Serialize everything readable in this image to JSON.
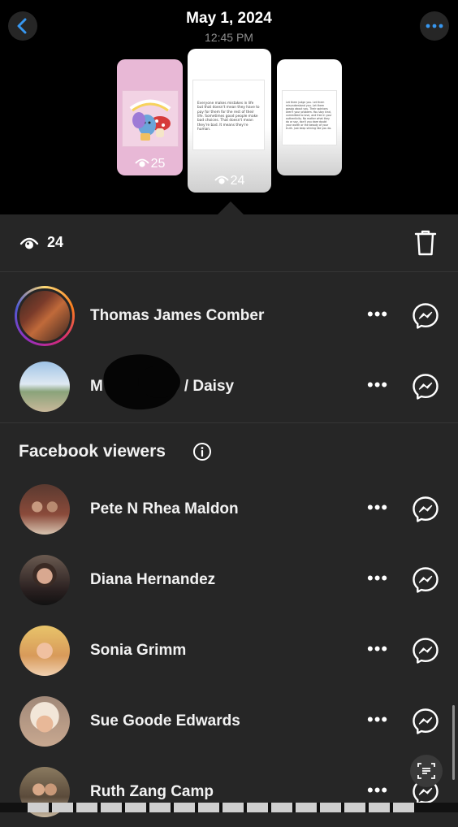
{
  "header": {
    "date": "May 1, 2024",
    "time": "12:45 PM",
    "back_icon": "chevron-left-icon",
    "more_icon": "more-horizontal-icon"
  },
  "stories": [
    {
      "count": "25",
      "icon": "eye-icon"
    },
    {
      "count": "24",
      "icon": "eye-icon",
      "selected": true,
      "text": "Everyone makes mistakes in life but that doesn't mean they have to pay for them for the rest of their life. Sometimes good people make bad choices. That doesn't mean they're bad. It means they're human."
    },
    {
      "count": "",
      "text": "Let them judge you. Let them misunderstand you. Let them gossip about you. Their opinions aren't your problem. You stay kind, committed to love, and free in your authenticity. No matter what they do or say, don't you dare doubt your worth or the beauty of your truth. Just keep shining like you do."
    }
  ],
  "summary": {
    "view_count": "24",
    "eye_icon": "eye-icon",
    "delete_icon": "trash-icon"
  },
  "viewers": [
    {
      "name": "Thomas James Comber",
      "has_story_ring": true
    },
    {
      "name_prefix": "M",
      "name_suffix": "/ Daisy",
      "partially_obscured": true
    }
  ],
  "facebook_section": {
    "title": "Facebook viewers",
    "info_icon": "info-icon"
  },
  "facebook_viewers": [
    {
      "name": "Pete N Rhea Maldon"
    },
    {
      "name": "Diana Hernandez"
    },
    {
      "name": "Sonia Grimm"
    },
    {
      "name": "Sue Goode Edwards"
    },
    {
      "name": "Ruth Zang Camp"
    }
  ],
  "row_actions": {
    "more_label": "•••",
    "message_icon": "messenger-icon"
  },
  "floating_button_icon": "scan-text-icon",
  "colors": {
    "sheet_bg": "#262626",
    "top_bg": "#000000",
    "accent_blue": "#3797f0"
  }
}
